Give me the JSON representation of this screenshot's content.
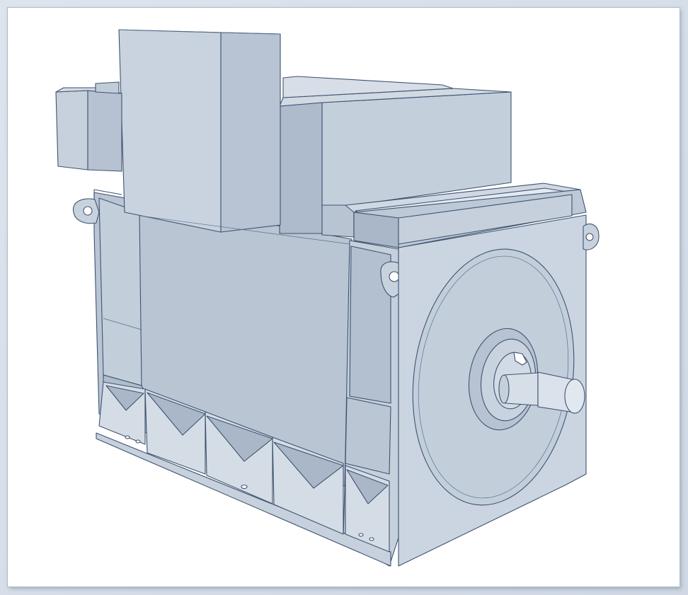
{
  "illustration": {
    "subject": "electric-motor-isometric",
    "colors": {
      "background": "#ffffff",
      "frame": "#d3dbe6",
      "face_light": "#cdd7e2",
      "face_mid": "#bcc8d6",
      "face_dark": "#aab8c9",
      "outline": "#3e536f"
    }
  }
}
